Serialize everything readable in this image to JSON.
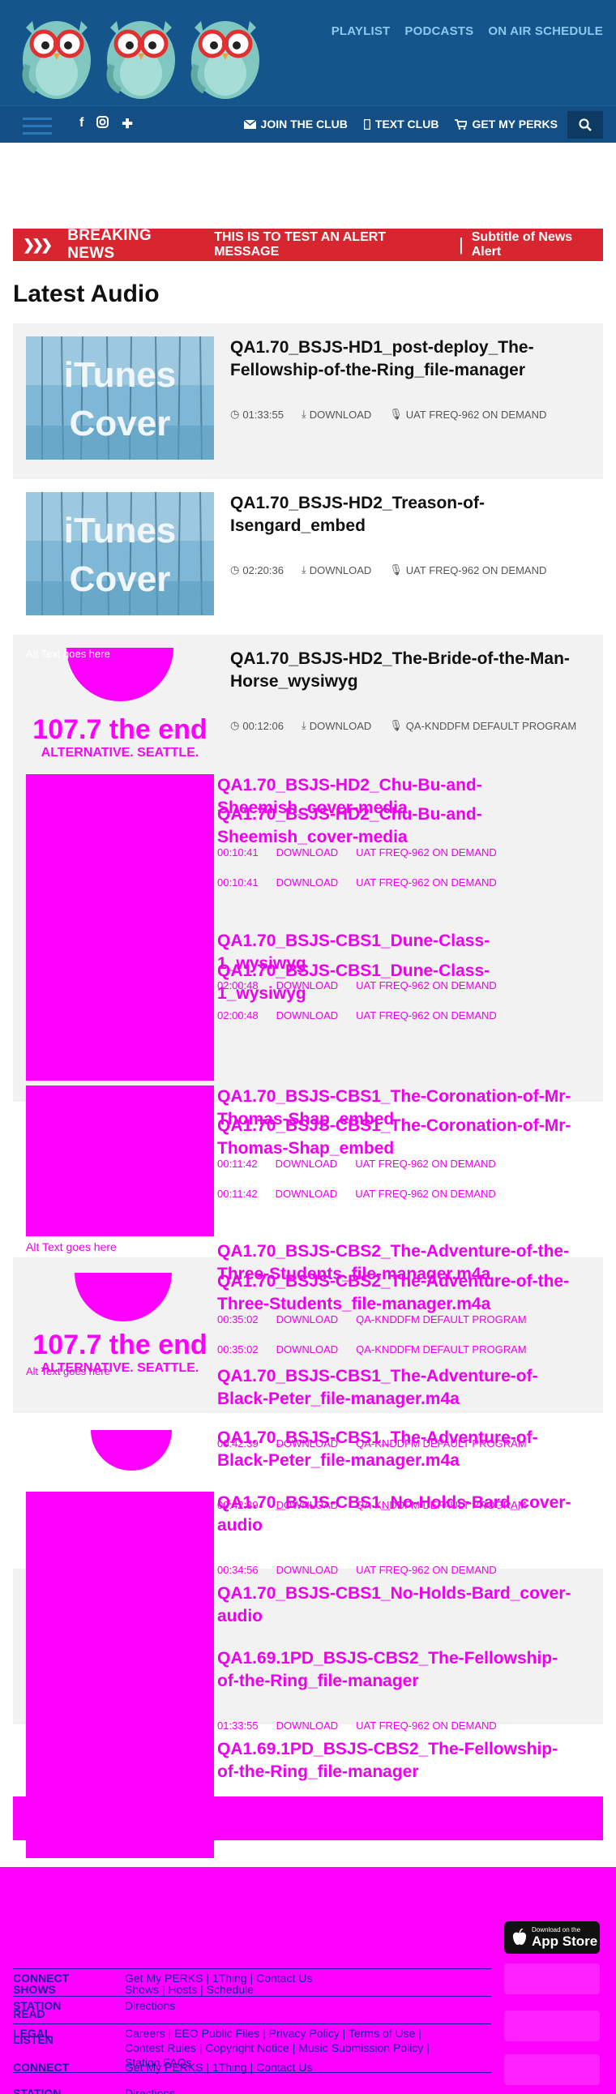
{
  "header": {
    "nav": [
      "PLAYLIST",
      "PODCASTS",
      "ON AIR SCHEDULE"
    ],
    "club_links": [
      {
        "icon": "envelope-icon",
        "label": "JOIN THE CLUB"
      },
      {
        "icon": "mobile-icon",
        "label": "TEXT CLUB"
      },
      {
        "icon": "cart-icon",
        "label": "GET MY PERKS"
      }
    ],
    "social": [
      "f",
      "instagram",
      "+"
    ]
  },
  "breaking": {
    "title": "BREAKING NEWS",
    "message": "THIS IS TO TEST AN ALERT MESSAGE",
    "subtitle": "Subtitle of News Alert"
  },
  "section_title": "Latest Audio",
  "audio": [
    {
      "title": "QA1.70_BSJS-HD1_post-deploy_The-Fellowship-of-the-Ring_file-manager",
      "duration": "01:33:55",
      "download": "DOWNLOAD",
      "program": "UAT FREQ-962 ON DEMAND",
      "thumb": "itunes",
      "thumb_text": [
        "iTunes",
        "Cover"
      ]
    },
    {
      "title": "QA1.70_BSJS-HD2_Treason-of-Isengard_embed",
      "duration": "02:20:36",
      "download": "DOWNLOAD",
      "program": "UAT FREQ-962 ON DEMAND",
      "thumb": "itunes",
      "thumb_text": [
        "iTunes",
        "Cover"
      ]
    },
    {
      "title": "QA1.70_BSJS-HD2_The-Bride-of-the-Man-Horse_wysiwyg",
      "duration": "00:12:06",
      "download": "DOWNLOAD",
      "program": "QA-KNDDFM DEFAULT PROGRAM",
      "thumb": "station",
      "alt_text": "Alt Text goes here",
      "station_line1": "107.7 the end",
      "station_line2": "ALTERNATIVE. SEATTLE."
    }
  ],
  "glitch_audio": [
    {
      "title": "QA1.70_BSJS-HD2_Chu-Bu-and-Sheemish_cover-media",
      "duration": "00:10:41",
      "download": "DOWNLOAD",
      "program": "UAT FREQ-962 ON DEMAND"
    },
    {
      "title": "QA1.70_BSJS-CBS1_Dune-Class-1_wysiwyg",
      "duration": "02:00:48",
      "download": "DOWNLOAD",
      "program": "UAT FREQ-962 ON DEMAND"
    },
    {
      "title": "QA1.70_BSJS-CBS1_The-Coronation-of-Mr-Thomas-Shap_embed",
      "duration": "00:11:42",
      "download": "DOWNLOAD",
      "program": "UAT FREQ-962 ON DEMAND"
    },
    {
      "title": "QA1.70_BSJS-CBS2_The-Adventure-of-the-Three-Students_file-manager.m4a",
      "duration": "00:35:02",
      "download": "DOWNLOAD",
      "program": "QA-KNDDFM DEFAULT PROGRAM"
    },
    {
      "title": "QA1.70_BSJS-CBS1_The-Adventure-of-Black-Peter_file-manager.m4a",
      "duration": "00:42:39",
      "download": "DOWNLOAD",
      "program": "QA-KNDDFM DEFAULT PROGRAM"
    },
    {
      "title": "QA1.70_BSJS-CBS1_No-Holds-Bard_cover-audio",
      "duration": "00:34:56",
      "download": "DOWNLOAD",
      "program": "UAT FREQ-962 ON DEMAND"
    },
    {
      "title": "QA1.69.1PD_BSJS-CBS2_The-Fellowship-of-the-Ring_file-manager",
      "duration": "01:33:55",
      "download": "DOWNLOAD",
      "program": "UAT FREQ-962 ON DEMAND"
    }
  ],
  "glitch_alt_text": "Alt Text goes here",
  "footer": {
    "app_store_small": "Download on the",
    "app_store_large": "App Store",
    "rows": [
      {
        "label": "CONNECT",
        "links": "Get My PERKS | 1Thing | Contact Us"
      },
      {
        "label": "STATION",
        "links": "Directions"
      },
      {
        "label": "LEGAL",
        "links": "Careers | EEO Public Files | Privacy Policy | Terms of Use |"
      },
      {
        "label": "",
        "links": "Contest Rules | Copyright Notice | Music Submission Policy |"
      },
      {
        "label": "CONNECT",
        "links": "Get My PERKS | 1Thing | Contact Us"
      },
      {
        "label": "STATION",
        "links": "Directions"
      }
    ],
    "ghost_rows": [
      {
        "label": "SHOWS",
        "links": "Shows | Hosts | Schedule"
      },
      {
        "label": "READ",
        "links": ""
      },
      {
        "label": "LISTEN",
        "links": ""
      },
      {
        "label": "",
        "links": "Station FAQs"
      }
    ]
  }
}
